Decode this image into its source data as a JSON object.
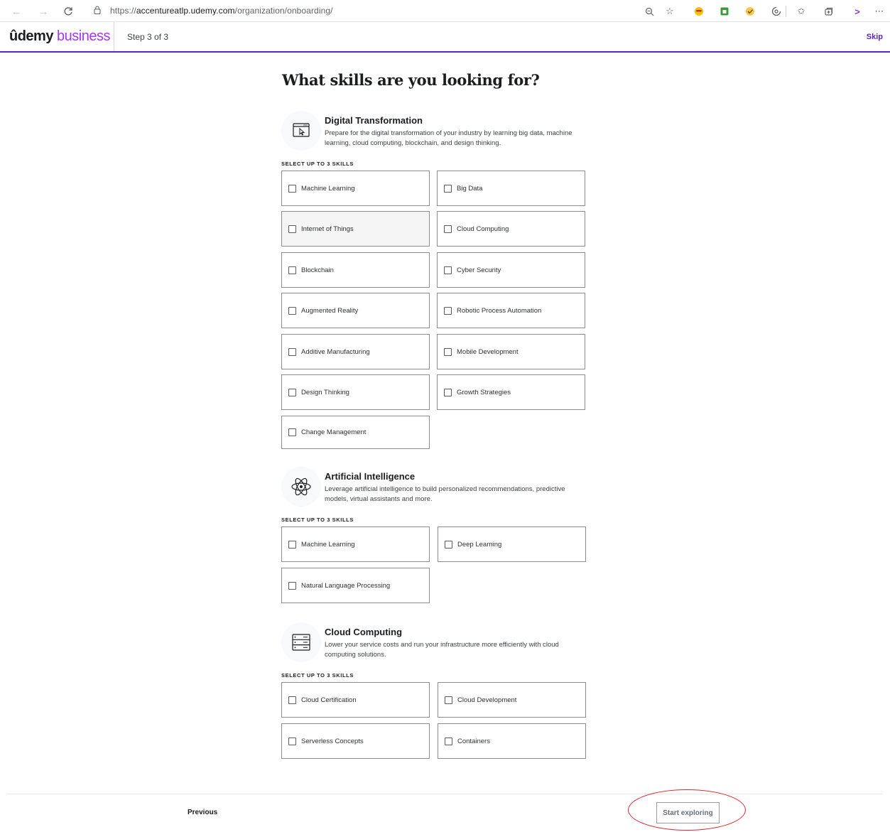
{
  "browser": {
    "url_prefix": "https://",
    "url_host": "accentureatlp.udemy.com",
    "url_path": "/organization/onboarding/"
  },
  "header": {
    "logo_u": "ûdemy",
    "logo_business": "business",
    "step": "Step 3 of 3",
    "skip": "Skip"
  },
  "page": {
    "title": "What skills are you looking for?"
  },
  "sections": [
    {
      "title": "Digital Transformation",
      "description": "Prepare for the digital transformation of your industry by learning big data, machine learning, cloud computing, blockchain, and design thinking.",
      "select_label": "SELECT UP TO 3 SKILLS",
      "icon": "browser-cursor-icon",
      "skills": [
        "Machine Learning",
        "Big Data",
        "Internet of Things",
        "Cloud Computing",
        "Blockchain",
        "Cyber Security",
        "Augmented Reality",
        "Robotic Process Automation",
        "Additive Manufacturing",
        "Mobile Development",
        "Design Thinking",
        "Growth Strategies",
        "Change Management"
      ]
    },
    {
      "title": "Artificial Intelligence",
      "description": "Leverage artificial intelligence to build personalized recommendations, predictive models, virtual assistants and more.",
      "select_label": "SELECT UP TO 3 SKILLS",
      "icon": "atom-icon",
      "skills": [
        "Machine Learning",
        "Deep Learning",
        "Natural Language Processing"
      ]
    },
    {
      "title": "Cloud Computing",
      "description": "Lower your service costs and run your infrastructure more efficiently with cloud computing solutions.",
      "select_label": "SELECT UP TO 3 SKILLS",
      "icon": "server-rack-icon",
      "skills": [
        "Cloud Certification",
        "Cloud Development",
        "Serverless Concepts",
        "Containers"
      ]
    }
  ],
  "footer": {
    "previous": "Previous",
    "start": "Start exploring"
  },
  "colors": {
    "brand_purple": "#5624d0",
    "logo_purple": "#a435f0",
    "annotation_red": "#d9232e"
  }
}
